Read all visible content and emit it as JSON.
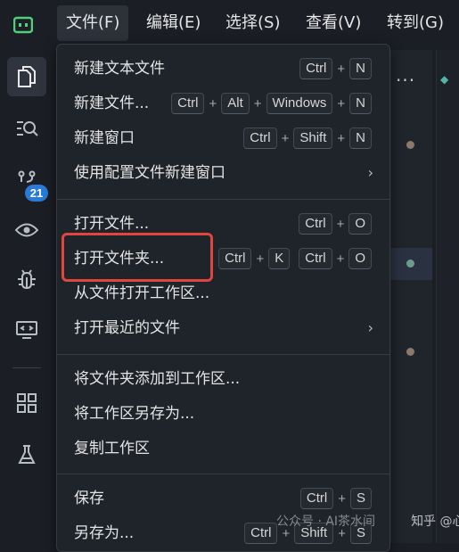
{
  "menubar": {
    "items": [
      {
        "label": "文件(F)",
        "active": true
      },
      {
        "label": "编辑(E)"
      },
      {
        "label": "选择(S)"
      },
      {
        "label": "查看(V)"
      },
      {
        "label": "转到(G)"
      }
    ]
  },
  "activity": {
    "source_control_badge": "21",
    "icons": [
      "explorer-icon",
      "search-icon",
      "source-control-icon",
      "preview-icon",
      "debug-icon",
      "remote-icon",
      "extensions-icon",
      "testing-icon"
    ]
  },
  "file_menu": {
    "items": [
      {
        "label": "新建文本文件",
        "shortcut": [
          [
            "Ctrl",
            "N"
          ]
        ]
      },
      {
        "label": "新建文件...",
        "shortcut": [
          [
            "Ctrl",
            "Alt",
            "Windows",
            "N"
          ]
        ]
      },
      {
        "label": "新建窗口",
        "shortcut": [
          [
            "Ctrl",
            "Shift",
            "N"
          ]
        ]
      },
      {
        "label": "使用配置文件新建窗口",
        "submenu": true
      },
      {
        "label": "打开文件...",
        "shortcut": [
          [
            "Ctrl",
            "O"
          ]
        ]
      },
      {
        "label": "打开文件夹...",
        "shortcut": [
          [
            "Ctrl",
            "K"
          ],
          [
            "Ctrl",
            "O"
          ]
        ]
      },
      {
        "label": "从文件打开工作区..."
      },
      {
        "label": "打开最近的文件",
        "submenu": true
      },
      {
        "label": "将文件夹添加到工作区..."
      },
      {
        "label": "将工作区另存为..."
      },
      {
        "label": "复制工作区"
      },
      {
        "label": "保存",
        "shortcut": [
          [
            "Ctrl",
            "S"
          ]
        ]
      },
      {
        "label": "另存为...",
        "shortcut": [
          [
            "Ctrl",
            "Shift",
            "S"
          ]
        ]
      }
    ],
    "plus": "+",
    "chevron": "›"
  },
  "background": {
    "more_actions": "···"
  },
  "watermark": {
    "source": "公众号 · AI茶水间",
    "author": "知乎 @心易"
  },
  "colors": {
    "highlight_border": "#e0453e",
    "badge": "#2b7bd6",
    "app_icon": "#4fd07a"
  }
}
